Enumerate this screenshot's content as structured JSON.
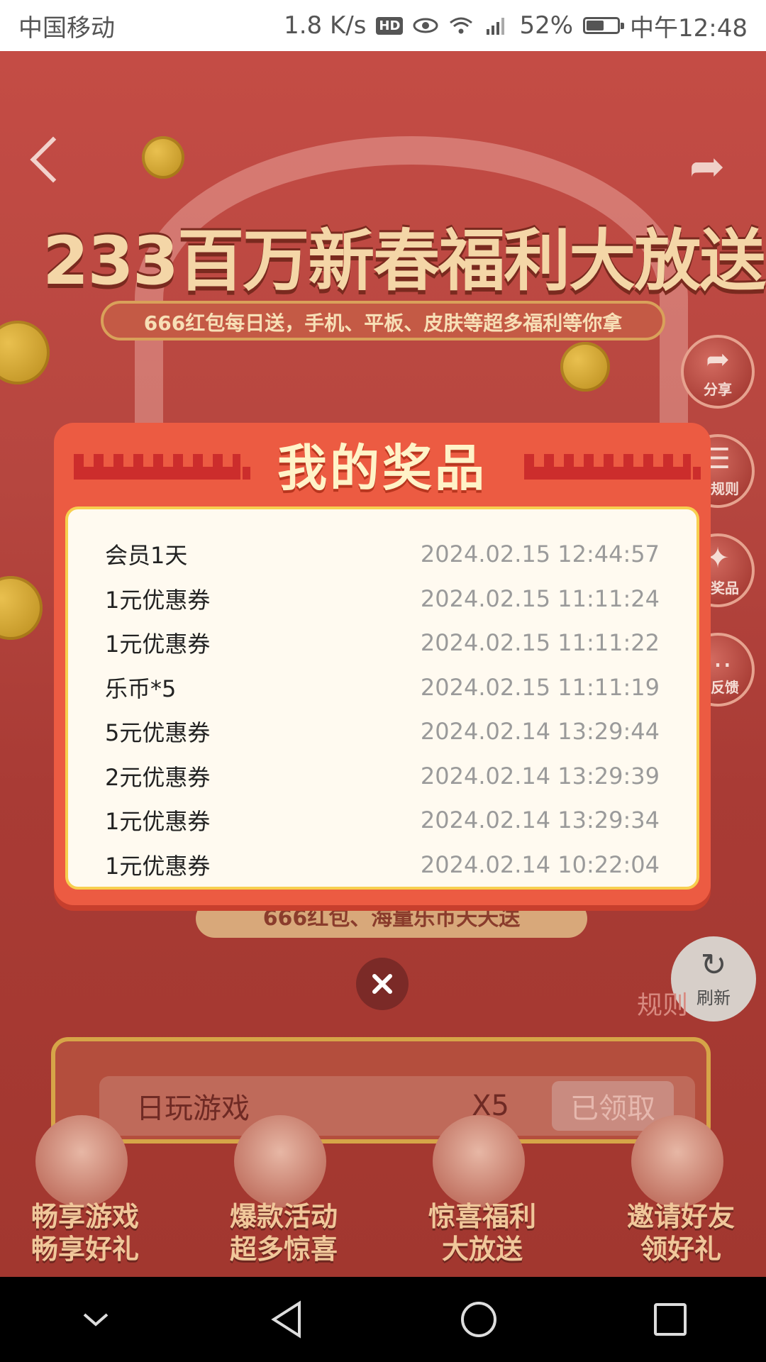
{
  "status_bar": {
    "carrier": "中国移动",
    "speed": "1.8 K/s",
    "hd": "HD",
    "battery_percent": "52%",
    "time": "中午12:48"
  },
  "background": {
    "banner_title": "233百万新春福利大放送",
    "banner_subtitle": "666红包每日送，手机、平板、皮肤等超多福利等你拿",
    "side_buttons": [
      {
        "label": "分享",
        "glyph": "➦"
      },
      {
        "label": "动规则",
        "glyph": "☰"
      },
      {
        "label": "的奖品",
        "glyph": "✦"
      },
      {
        "label": "题反馈",
        "glyph": "…"
      }
    ],
    "under_pill": "666红包、海量乐币天天送",
    "refresh_label": "刷新",
    "rules_link": "规则",
    "task": {
      "name": "日玩游戏",
      "multiplier": "X5",
      "status": "已领取"
    },
    "promos": [
      {
        "line1": "畅享游戏",
        "line2": "畅享好礼"
      },
      {
        "line1": "爆款活动",
        "line2": "超多惊喜"
      },
      {
        "line1": "惊喜福利",
        "line2": "大放送"
      },
      {
        "line1": "邀请好友",
        "line2": "领好礼"
      }
    ]
  },
  "modal": {
    "title": "我的奖品",
    "prizes": [
      {
        "name": "会员1天",
        "time": "2024.02.15 12:44:57"
      },
      {
        "name": "1元优惠券",
        "time": "2024.02.15 11:11:24"
      },
      {
        "name": "1元优惠券",
        "time": "2024.02.15 11:11:22"
      },
      {
        "name": "乐币*5",
        "time": "2024.02.15 11:11:19"
      },
      {
        "name": "5元优惠券",
        "time": "2024.02.14 13:29:44"
      },
      {
        "name": "2元优惠券",
        "time": "2024.02.14 13:29:39"
      },
      {
        "name": "1元优惠券",
        "time": "2024.02.14 13:29:34"
      },
      {
        "name": "1元优惠券",
        "time": "2024.02.14 10:22:04"
      }
    ]
  },
  "colors": {
    "modal_bg": "#ec5b42",
    "panel_bg": "#fffaf0",
    "title": "#fff3c8",
    "close_bg": "#7b2a27"
  }
}
